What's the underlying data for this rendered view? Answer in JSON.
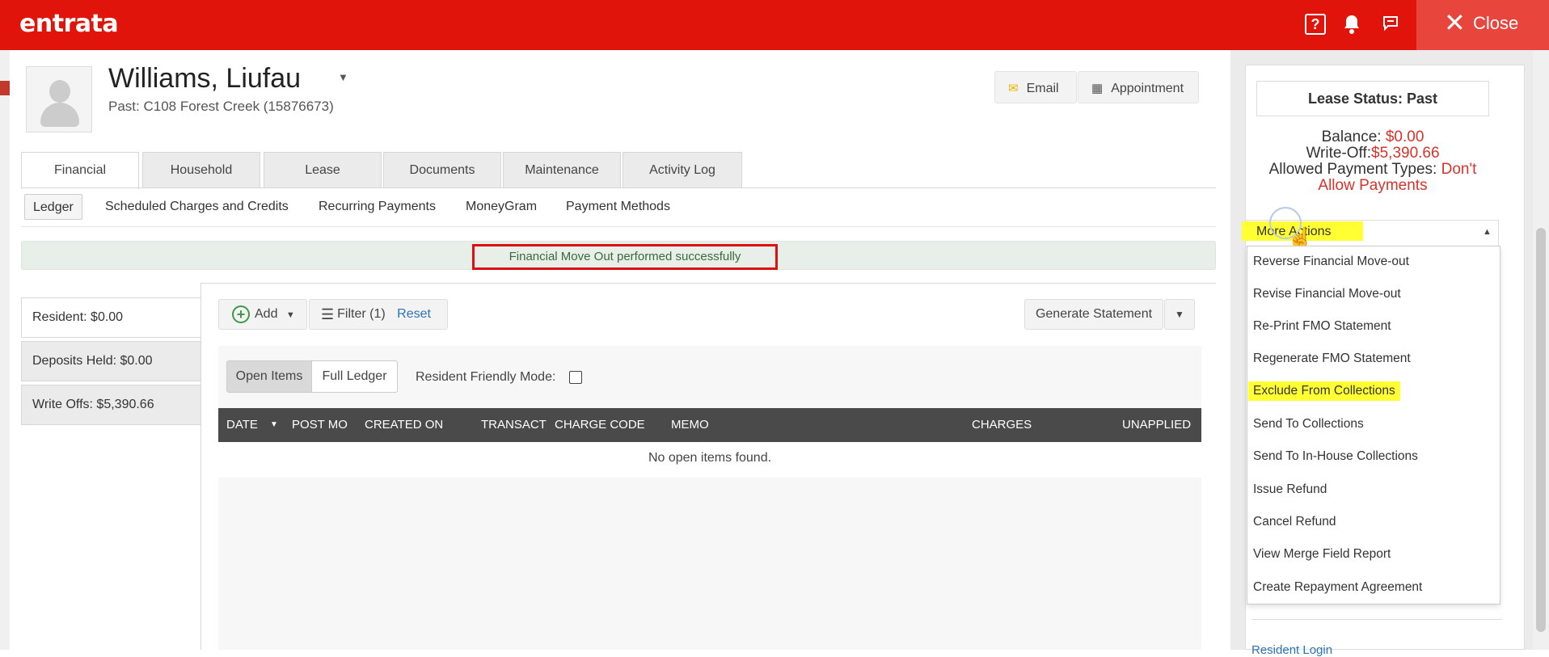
{
  "app": {
    "logo": "entrata",
    "help_icon": "?",
    "close_label": "Close"
  },
  "resident": {
    "name": "Williams, Liufau",
    "subtitle": "Past: C108 Forest Creek (15876673)"
  },
  "header_buttons": {
    "email": "Email",
    "appointment": "Appointment"
  },
  "tabs": [
    "Financial",
    "Household",
    "Lease",
    "Documents",
    "Maintenance",
    "Activity Log"
  ],
  "subtabs": [
    "Ledger",
    "Scheduled Charges and Credits",
    "Recurring Payments",
    "MoneyGram",
    "Payment Methods"
  ],
  "alert": "Financial Move Out performed successfully",
  "summary": {
    "resident": "Resident: $0.00",
    "deposits": "Deposits Held: $0.00",
    "write_offs": "Write Offs: $5,390.66"
  },
  "toolbar": {
    "add": "Add",
    "filter": "Filter (1)",
    "reset": "Reset",
    "generate": "Generate Statement"
  },
  "view": {
    "open_items": "Open Items",
    "full_ledger": "Full Ledger",
    "resident_friendly": "Resident Friendly Mode:"
  },
  "table": {
    "columns": [
      "DATE",
      "POST MO",
      "CREATED ON",
      "TRANSACT",
      "CHARGE CODE",
      "MEMO",
      "CHARGES",
      "UNAPPLIED"
    ],
    "empty": "No open items found."
  },
  "lease_panel": {
    "status": "Lease Status: Past",
    "balance_label": "Balance: ",
    "balance_value": "$0.00",
    "writeoff_label": "Write-Off:",
    "writeoff_value": "$5,390.66",
    "payment_types_label": "Allowed Payment Types: ",
    "payment_types_value_1": "Don't",
    "payment_types_value_2": "Allow Payments",
    "more_actions": "More Actions",
    "actions": [
      "Reverse Financial Move-out",
      "Revise Financial Move-out",
      "Re-Print FMO Statement",
      "Regenerate FMO Statement",
      "Exclude From Collections",
      "Send To Collections",
      "Send To In-House Collections",
      "Issue Refund",
      "Cancel Refund",
      "View Merge Field Report",
      "Create Repayment Agreement"
    ],
    "resident_login": "Resident Login"
  },
  "colors": {
    "brand_red": "#e0140a",
    "highlight_yellow": "#ffff33",
    "alert_border": "#dd1111"
  }
}
